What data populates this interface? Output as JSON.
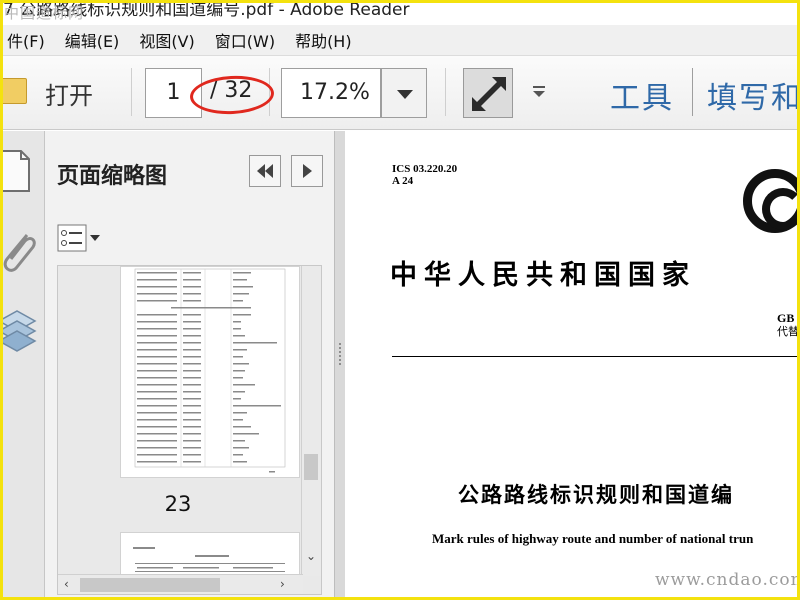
{
  "watermark": {
    "top_left": "中国道标网",
    "bottom_right": "www.cndao.com"
  },
  "window": {
    "title": "7 公路路线标识规则和国道编号.pdf - Adobe Reader"
  },
  "menu": [
    "件(F)",
    "编辑(E)",
    "视图(V)",
    "窗口(W)",
    "帮助(H)"
  ],
  "toolbar": {
    "open_label": "打开",
    "current_page": "1",
    "page_total": "/ 32",
    "zoom": "17.2%",
    "tools_label": "工具",
    "fill_sign_label": "填写和"
  },
  "thumbnail_panel": {
    "title": "页面缩略图",
    "thumbs": [
      {
        "label": "23"
      }
    ]
  },
  "document": {
    "ics": "ICS 03.220.20",
    "class_code": "A 24",
    "country": "中华人民共和国国家",
    "gb_code": "GB",
    "replaces": "代替",
    "title_cn": "公路路线标识规则和国道编",
    "title_en": "Mark rules of highway route and number of national trun"
  },
  "colors": {
    "frame": "#f4e20e",
    "accent_link": "#2f69a8",
    "annotation": "#e0281e"
  }
}
